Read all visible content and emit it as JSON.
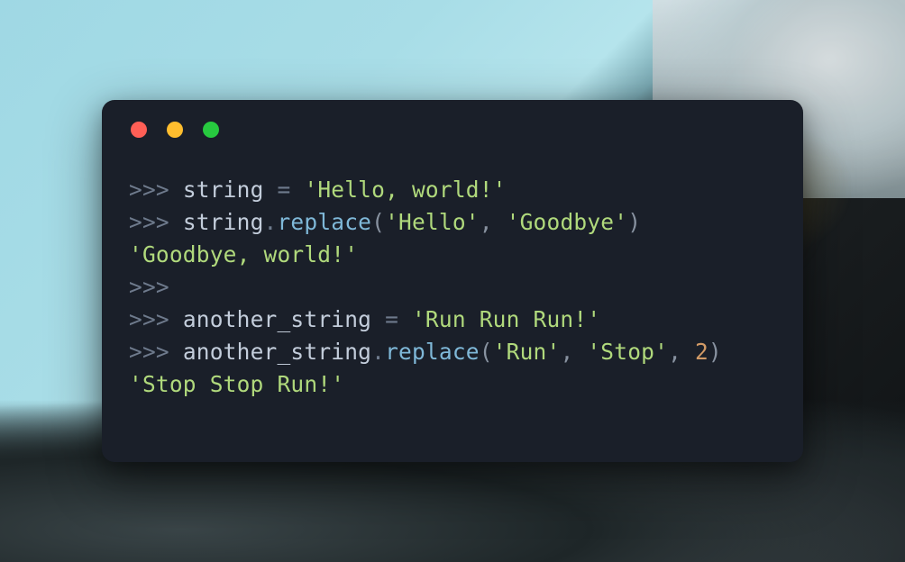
{
  "terminal": {
    "traffic_lights": [
      "red",
      "yellow",
      "green"
    ],
    "prompt": ">>> ",
    "prompt_empty": ">>>",
    "lines": {
      "l1": {
        "var": "string",
        "op": " = ",
        "str": "'Hello, world!'"
      },
      "l2": {
        "var": "string",
        "dot": ".",
        "func": "replace",
        "lp": "(",
        "arg1": "'Hello'",
        "comma1": ", ",
        "arg2": "'Goodbye'",
        "rp": ")"
      },
      "l3": {
        "out": "'Goodbye, world!'"
      },
      "l5": {
        "var": "another_string",
        "op": " = ",
        "str": "'Run Run Run!'"
      },
      "l6": {
        "var": "another_string",
        "dot": ".",
        "func": "replace",
        "lp": "(",
        "arg1": "'Run'",
        "comma1": ", ",
        "arg2": "'Stop'",
        "comma2": ", ",
        "arg3": "2",
        "rp": ")"
      },
      "l7": {
        "out": "'Stop Stop Run!'"
      }
    }
  }
}
